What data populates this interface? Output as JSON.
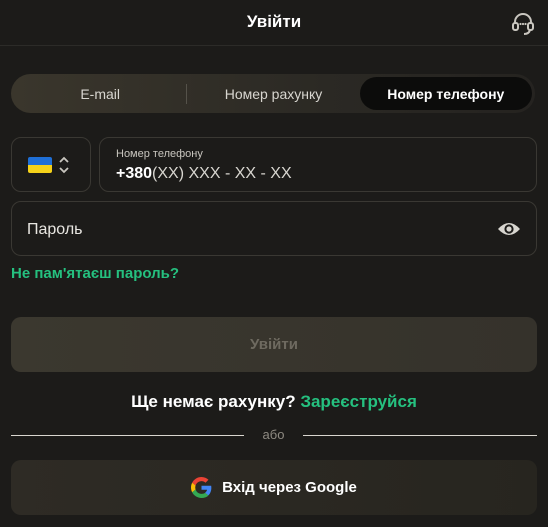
{
  "header": {
    "title": "Увійти",
    "support_icon": "headset-icon"
  },
  "tabs": [
    {
      "label": "E-mail",
      "active": false
    },
    {
      "label": "Номер рахунку",
      "active": false
    },
    {
      "label": "Номер телефону",
      "active": true
    }
  ],
  "phone": {
    "country_flag": "ukraine-flag",
    "label": "Номер телефону",
    "prefix": "+380",
    "mask": "(XX) XXX - XX - XX"
  },
  "password": {
    "placeholder": "Пароль",
    "toggle_icon": "eye-icon"
  },
  "forgot_password": "Не пам'ятаєш пароль?",
  "submit_label": "Увійти",
  "register": {
    "text": "Ще немає рахунку?",
    "link": "Зареєструйся"
  },
  "divider_text": "або",
  "google": {
    "label": "Вхід через Google",
    "icon": "google-icon"
  },
  "colors": {
    "accent": "#25c07f",
    "background": "#1c1b19"
  }
}
